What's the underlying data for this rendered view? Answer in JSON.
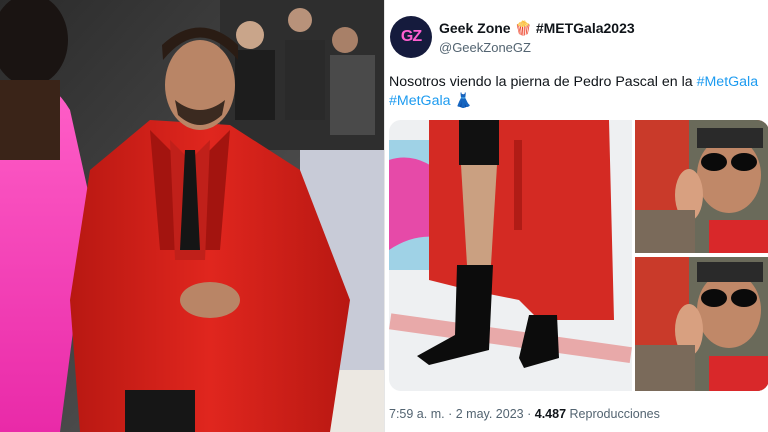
{
  "tweet": {
    "display_name": "Geek Zone",
    "name_emoji": "🍿",
    "hashtag": "#METGala2023",
    "handle": "@GeekZoneGZ",
    "avatar_text": "GZ",
    "text_main": "Nosotros viendo la pierna de Pedro Pascal en la ",
    "text_link1": "#MetGala",
    "text_link2": "#MetGala",
    "text_emoji": "👗",
    "time": "7:59 a. m.",
    "separator": "·",
    "date": "2 may. 2023",
    "views_count": "4.487",
    "views_label": "Reproducciones"
  },
  "colors": {
    "link": "#1d9bf0",
    "text": "#0f1419",
    "muted": "#536471",
    "coat_red": "#d42a23"
  },
  "images": {
    "left_photo": "red-carpet-red-coat-photo",
    "media_main": "red-coat-leg-photo",
    "media_top_right": "sunglasses-man-photo",
    "media_bottom_right": "sunglasses-man-photo"
  }
}
